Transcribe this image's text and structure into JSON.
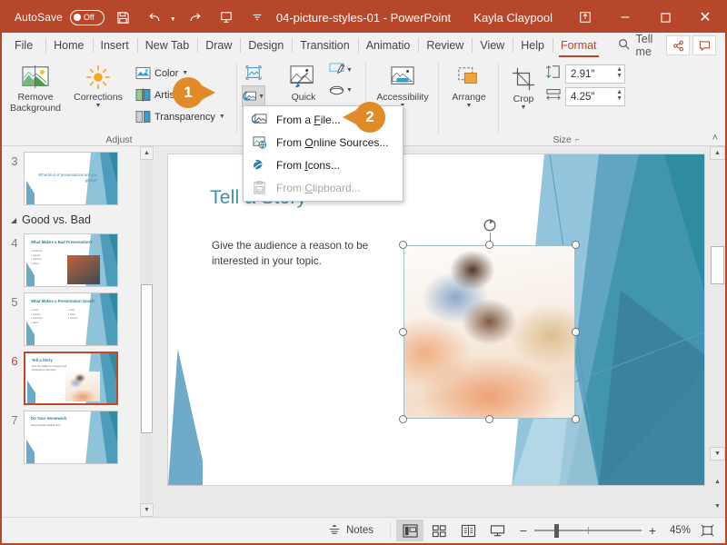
{
  "titlebar": {
    "autosave_label": "AutoSave",
    "autosave_state": "Off",
    "save_icon": "save-icon",
    "undo_icon": "undo-icon",
    "redo_icon": "redo-icon",
    "present_icon": "start-presentation-icon",
    "more_icon": "customize-qat-icon",
    "document_title": "04-picture-styles-01  -  PowerPoint",
    "user_name": "Kayla Claypool",
    "ribbon_display_icon": "ribbon-display-options-icon",
    "minimize_label": "–",
    "restore_label": "❐",
    "close_label": "✕"
  },
  "tabs": [
    {
      "label": "File",
      "active": false
    },
    {
      "label": "Home",
      "active": false
    },
    {
      "label": "Insert",
      "active": false
    },
    {
      "label": "New Tab",
      "active": false
    },
    {
      "label": "Draw",
      "active": false
    },
    {
      "label": "Design",
      "active": false
    },
    {
      "label": "Transition",
      "active": false
    },
    {
      "label": "Animatio",
      "active": false
    },
    {
      "label": "Review",
      "active": false
    },
    {
      "label": "View",
      "active": false
    },
    {
      "label": "Help",
      "active": false
    },
    {
      "label": "Format",
      "active": true
    }
  ],
  "tellme": {
    "label": "Tell me",
    "icon": "search-icon"
  },
  "tab_right_icons": {
    "share": "share-icon",
    "comments": "comments-icon"
  },
  "ribbon": {
    "adjust": {
      "group_label": "Adjust",
      "remove_background": "Remove\nBackground",
      "remove_background_label_line1": "Remove",
      "remove_background_label_line2": "Background",
      "corrections": "Corrections",
      "color": "Color",
      "artistic": "Artistic",
      "transparency": "Transparency"
    },
    "picture_styles": {
      "reset_picture_icon": "reset-picture-icon",
      "change_picture_icon": "change-picture-icon",
      "quick_label": "Quick",
      "picture_border_icon": "picture-border-icon",
      "picture_effects_icon": "picture-effects-icon"
    },
    "accessibility": {
      "label": "Accessibility",
      "icon": "alt-text-icon"
    },
    "arrange": {
      "label": "Arrange",
      "icon": "arrange-icon"
    },
    "size": {
      "group_label": "Size",
      "crop_label": "Crop",
      "crop_icon": "crop-icon",
      "height_icon": "shape-height-icon",
      "height_value": "2.91\"",
      "width_icon": "shape-width-icon",
      "width_value": "4.25\"",
      "dialog_launcher": "dialog-launcher-icon"
    },
    "collapse_icon": "collapse-ribbon-icon"
  },
  "dropdown": {
    "items": [
      {
        "label_pre": "From a ",
        "accel": "F",
        "label_post": "ile...",
        "icon": "from-file-icon",
        "disabled": false
      },
      {
        "label_pre": "From ",
        "accel": "O",
        "label_post": "nline Sources...",
        "icon": "from-online-icon",
        "disabled": false
      },
      {
        "label_pre": "From ",
        "accel": "I",
        "label_post": "cons...",
        "icon": "from-icons-icon",
        "disabled": false
      },
      {
        "label_pre": "From ",
        "accel": "C",
        "label_post": "lipboard...",
        "icon": "from-clipboard-icon",
        "disabled": true
      }
    ]
  },
  "callouts": [
    {
      "number": "1",
      "direction": "right"
    },
    {
      "number": "2",
      "direction": "left"
    }
  ],
  "thumbnails": {
    "items": [
      {
        "number": "3",
        "title": "What kind of presentations are you giving?",
        "kind": "centered",
        "selected": false
      },
      {
        "number": "4",
        "title": "What Makes a Bad Presentation?",
        "kind": "bullets-photo",
        "selected": false
      },
      {
        "number": "5",
        "title": "What Makes a Presentation Good?",
        "kind": "two-col-bullets",
        "selected": false
      },
      {
        "number": "6",
        "title": "Tell a Story",
        "kind": "text-photo",
        "selected": true
      },
      {
        "number": "7",
        "title": "Do Your Homework",
        "kind": "text-only",
        "selected": false
      }
    ],
    "section": {
      "label": "Good vs. Bad",
      "expanded": true
    }
  },
  "slide": {
    "title": "Tell a Story",
    "body": "Give the audience a reason to be interested in your topic.",
    "picture": {
      "alt": "woman and child reading a book",
      "selected": true
    }
  },
  "statusbar": {
    "notes_label": "Notes",
    "notes_icon": "notes-icon",
    "views": [
      {
        "name": "normal-view",
        "icon": "normal-view-icon",
        "active": true
      },
      {
        "name": "slide-sorter-view",
        "icon": "slide-sorter-icon",
        "active": false
      },
      {
        "name": "reading-view",
        "icon": "reading-view-icon",
        "active": false
      },
      {
        "name": "slide-show-view",
        "icon": "slide-show-icon",
        "active": false
      }
    ],
    "zoom_out": "−",
    "zoom_in": "+",
    "zoom_level": "45%",
    "fit_window_icon": "fit-slide-to-window-icon"
  },
  "colors": {
    "brand": "#b7472a",
    "accent_orange": "#e08a28",
    "slide_title_blue": "#3d8fae",
    "deco_teal": "#2f8ba0"
  }
}
